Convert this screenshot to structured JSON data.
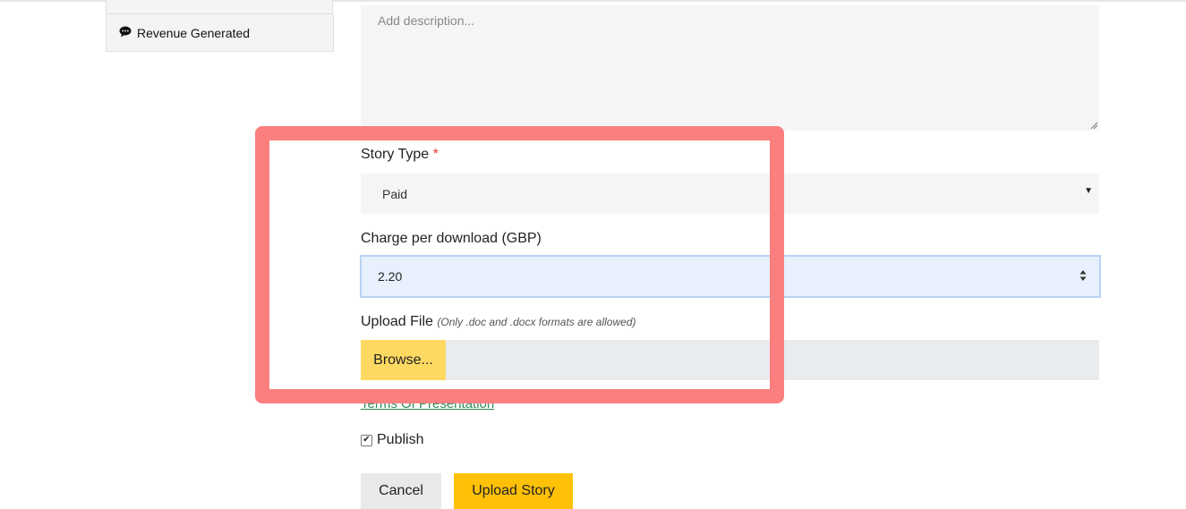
{
  "sidebar": {
    "items": [
      {
        "label": "Revenue Generated",
        "icon": "comment-icon"
      }
    ]
  },
  "form": {
    "description": {
      "placeholder": "Add description...",
      "value": ""
    },
    "story_type": {
      "label": "Story Type",
      "required_mark": "*",
      "selected": "Paid",
      "options": [
        "Paid"
      ]
    },
    "charge": {
      "label": "Charge per download (GBP)",
      "value": "2.20"
    },
    "upload_file": {
      "label": "Upload File",
      "hint": "(Only .doc and .docx formats are allowed)",
      "browse_label": "Browse..."
    },
    "terms_link": "Terms Of Presentation",
    "publish": {
      "label": "Publish",
      "checked": true
    },
    "buttons": {
      "cancel": "Cancel",
      "upload": "Upload Story"
    }
  },
  "colors": {
    "highlight": "#fc7f7f",
    "browse": "#fdd962",
    "upload_button": "#ffc107",
    "link": "#2e8b57",
    "required": "#e53935"
  }
}
